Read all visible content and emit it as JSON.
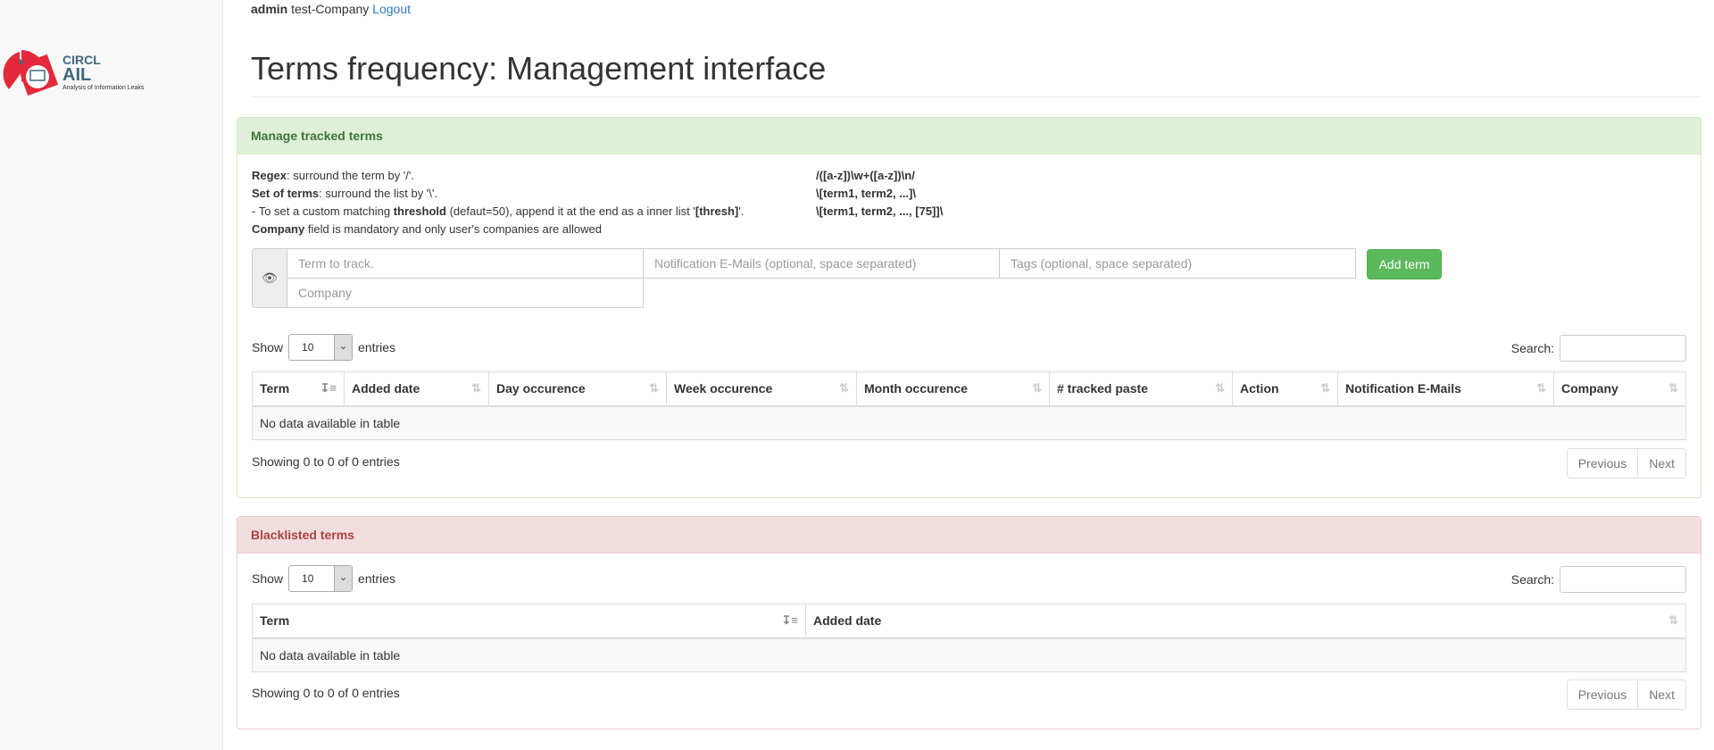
{
  "brand": {
    "org": "CIRCL",
    "name": "AIL",
    "tagline": "Analysis of Information Leaks",
    "colors": {
      "red": "#e3293a",
      "blue": "#40677f"
    }
  },
  "user": {
    "name": "admin",
    "company": "test-Company",
    "logout": "Logout"
  },
  "page_title": "Terms frequency: Management interface",
  "tracked": {
    "title": "Manage tracked terms",
    "help": [
      {
        "bold": "Regex",
        "text": ": surround the term by '/'.",
        "example": "/([a-z])\\w+([a-z])\\n/"
      },
      {
        "bold": "Set of terms",
        "text": ": surround the list by '\\'.",
        "example": "\\[term1, term2, ...]\\"
      },
      {
        "pre": "- To set a custom matching ",
        "bold": "threshold",
        "text": " (defaut=50), append it at the end as a inner list '",
        "bold2": "[thresh]",
        "post": "'.",
        "example": "\\[term1, term2, ..., [75]]\\"
      },
      {
        "bold": "Company",
        "text": " field is mandatory and only user's companies are allowed"
      }
    ],
    "icon": "eye-icon",
    "term_placeholder": "Term to track.",
    "emails_placeholder": "Notification E-Mails (optional, space separated)",
    "tags_placeholder": "Tags (optional, space separated)",
    "company_placeholder": "Company",
    "add_button": "Add term",
    "show": "Show",
    "length": "10",
    "entries": "entries",
    "search": "Search:",
    "columns": [
      "Term",
      "Added date",
      "Day occurence",
      "Week occurence",
      "Month occurence",
      "# tracked paste",
      "Action",
      "Notification E-Mails",
      "Company"
    ],
    "empty": "No data available in table",
    "info": "Showing 0 to 0 of 0 entries",
    "prev": "Previous",
    "next": "Next"
  },
  "blacklist": {
    "title": "Blacklisted terms",
    "show": "Show",
    "length": "10",
    "entries": "entries",
    "search": "Search:",
    "columns": [
      "Term",
      "Added date"
    ],
    "empty": "No data available in table",
    "info": "Showing 0 to 0 of 0 entries",
    "prev": "Previous",
    "next": "Next"
  }
}
